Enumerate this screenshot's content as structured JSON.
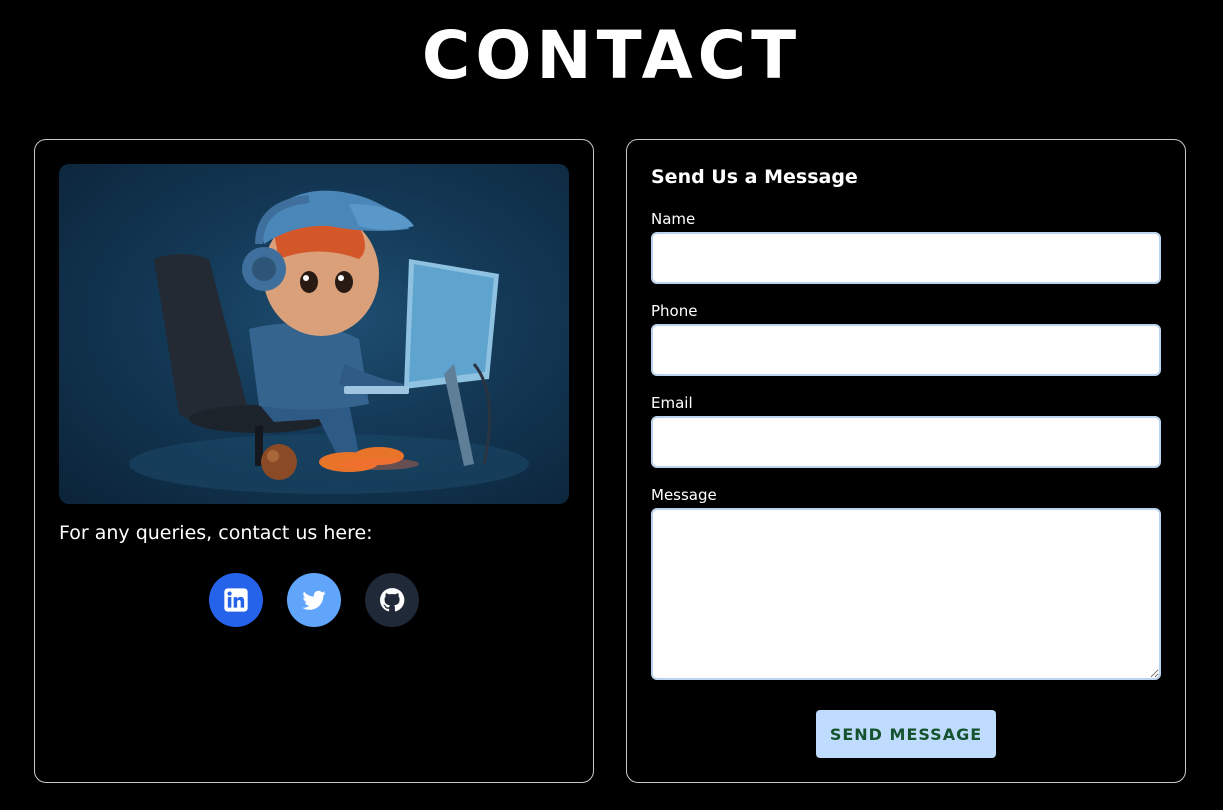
{
  "page": {
    "title": "CONTACT"
  },
  "info": {
    "contact_text": "For any queries, contact us here:",
    "socials": [
      {
        "name": "linkedin-icon",
        "color": "#2563eb"
      },
      {
        "name": "twitter-icon",
        "color": "#60a5fa"
      },
      {
        "name": "github-icon",
        "color": "#1f2937"
      }
    ]
  },
  "form": {
    "title": "Send Us a Message",
    "name_label": "Name",
    "name_value": "",
    "phone_label": "Phone",
    "phone_value": "",
    "email_label": "Email",
    "email_value": "",
    "message_label": "Message",
    "message_value": "",
    "submit_label": "SEND MESSAGE"
  },
  "colors": {
    "background": "#000000",
    "card_border": "#c9c9c9",
    "input_border": "#bcd3ef",
    "button_bg": "#bfdbfe",
    "button_text": "#14532d"
  }
}
